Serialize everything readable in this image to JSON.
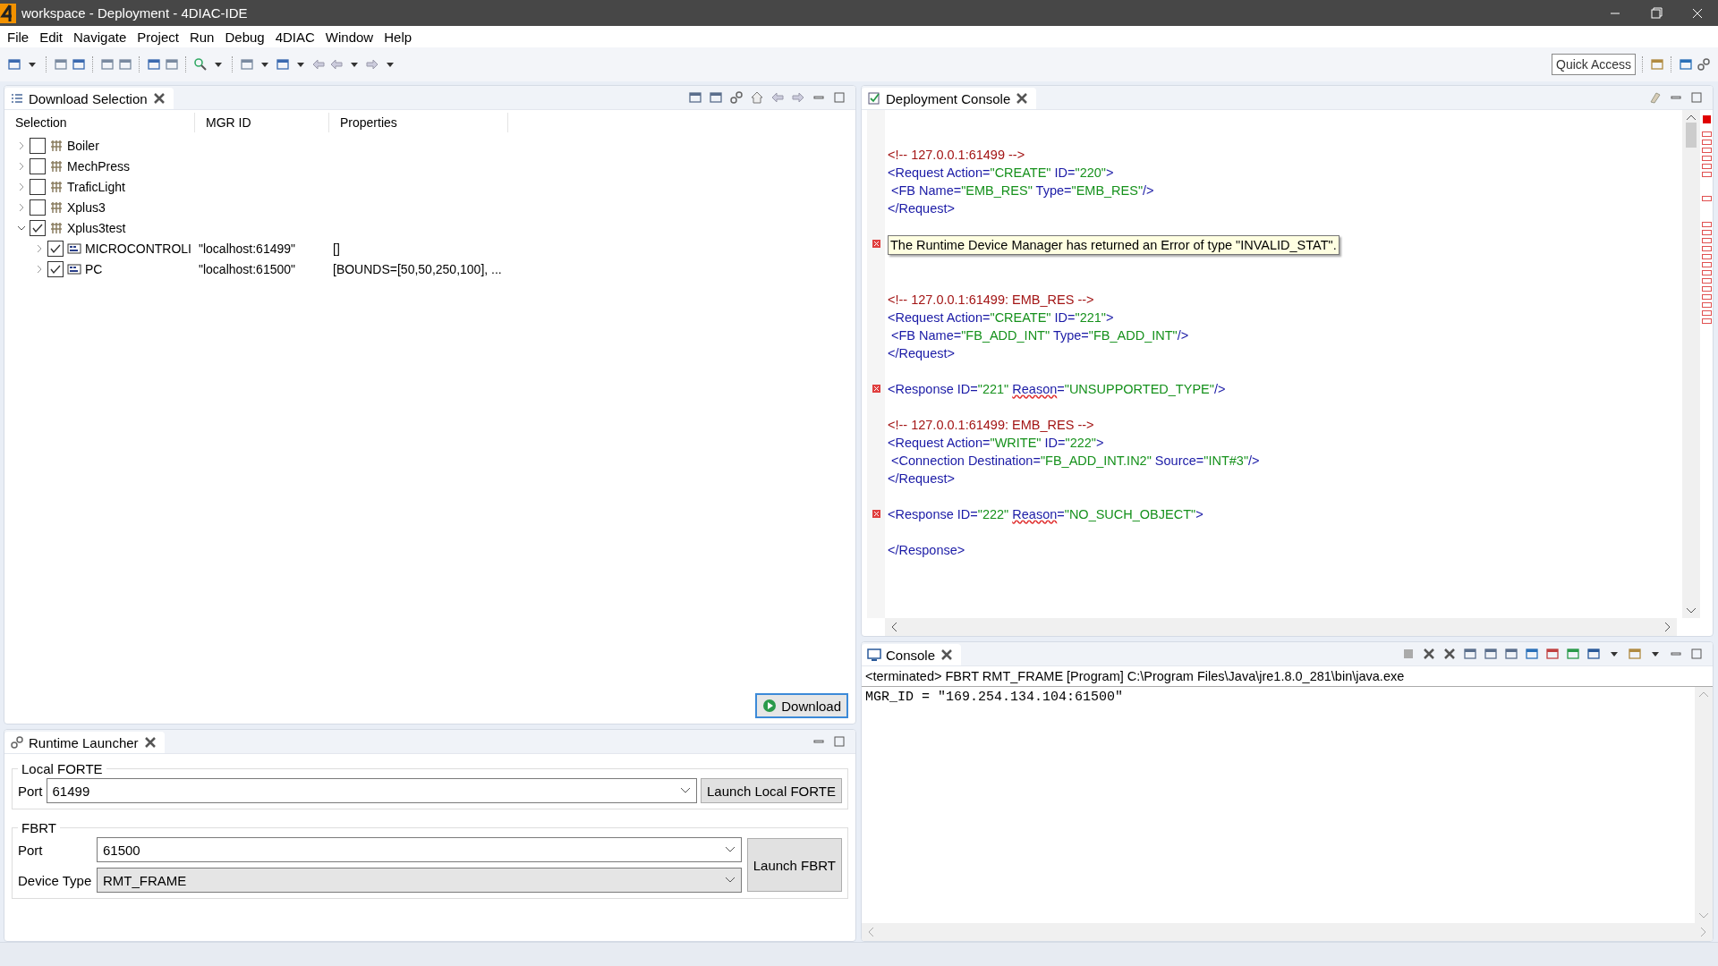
{
  "window": {
    "title": "workspace - Deployment - 4DIAC-IDE"
  },
  "menu": [
    "File",
    "Edit",
    "Navigate",
    "Project",
    "Run",
    "Debug",
    "4DIAC",
    "Window",
    "Help"
  ],
  "quick_access": {
    "placeholder": "Quick Access"
  },
  "download_selection": {
    "tab": "Download Selection",
    "columns": [
      "Selection",
      "MGR ID",
      "Properties"
    ],
    "tree": [
      {
        "label": "Boiler",
        "kind": "system",
        "checked": false,
        "expanded": false
      },
      {
        "label": "MechPress",
        "kind": "system",
        "checked": false,
        "expanded": false
      },
      {
        "label": "TraficLight",
        "kind": "system",
        "checked": false,
        "expanded": false
      },
      {
        "label": "Xplus3",
        "kind": "system",
        "checked": false,
        "expanded": false
      },
      {
        "label": "Xplus3test",
        "kind": "system",
        "checked": true,
        "expanded": true,
        "children": [
          {
            "label": "MICROCONTROLI",
            "kind": "device",
            "checked": true,
            "expanded": false,
            "mgr_id": "\"localhost:61499\"",
            "properties": "[]"
          },
          {
            "label": "PC",
            "kind": "device",
            "checked": true,
            "expanded": false,
            "mgr_id": "\"localhost:61500\"",
            "properties": "[BOUNDS=[50,50,250,100], ..."
          }
        ]
      }
    ],
    "download_button": "Download"
  },
  "deployment_console": {
    "tab": "Deployment Console",
    "entries": [
      {
        "kind": "request",
        "error": false,
        "lines": [
          [
            {
              "kind": "comment",
              "text": "<!-- 127.0.0.1:61499 -->"
            }
          ],
          [
            {
              "kind": "tag",
              "text": "<Request Action="
            },
            {
              "kind": "value",
              "text": "\"CREATE\""
            },
            {
              "kind": "tag",
              "text": " ID="
            },
            {
              "kind": "value",
              "text": "\"220\""
            },
            {
              "kind": "tag",
              "text": ">"
            }
          ],
          [
            {
              "kind": "tag",
              "text": " <FB Name="
            },
            {
              "kind": "value",
              "text": "\"EMB_RES\""
            },
            {
              "kind": "tag",
              "text": " Type="
            },
            {
              "kind": "value",
              "text": "\"EMB_RES\""
            },
            {
              "kind": "tag",
              "text": "/>"
            }
          ],
          [
            {
              "kind": "tag",
              "text": "</Request>"
            }
          ]
        ]
      },
      {
        "kind": "message",
        "error": true,
        "lines": [
          [
            {
              "kind": "plain",
              "text": "The Runtime Device Manager has returned an Error of type \"INVALID_STAT\"."
            }
          ]
        ]
      },
      {
        "kind": "request",
        "error": false,
        "lines": [
          [
            {
              "kind": "comment",
              "text": "<!-- 127.0.0.1:61499: EMB_RES -->"
            }
          ],
          [
            {
              "kind": "tag",
              "text": "<Request Action="
            },
            {
              "kind": "value",
              "text": "\"CREATE\""
            },
            {
              "kind": "tag",
              "text": " ID="
            },
            {
              "kind": "value",
              "text": "\"221\""
            },
            {
              "kind": "tag",
              "text": ">"
            }
          ],
          [
            {
              "kind": "tag",
              "text": " <FB Name="
            },
            {
              "kind": "value",
              "text": "\"FB_ADD_INT\""
            },
            {
              "kind": "tag",
              "text": " Type="
            },
            {
              "kind": "value",
              "text": "\"FB_ADD_INT\""
            },
            {
              "kind": "tag",
              "text": "/>"
            }
          ],
          [
            {
              "kind": "tag",
              "text": "</Request>"
            }
          ]
        ]
      },
      {
        "kind": "response",
        "error": true,
        "lines": [
          [
            {
              "kind": "tag",
              "text": "<Response ID="
            },
            {
              "kind": "value",
              "text": "\"221\" "
            },
            {
              "kind": "flagged",
              "text": "Reason"
            },
            {
              "kind": "tag",
              "text": "="
            },
            {
              "kind": "value",
              "text": "\"UNSUPPORTED_TYPE\""
            },
            {
              "kind": "tag",
              "text": "/>"
            }
          ]
        ]
      },
      {
        "kind": "request",
        "error": false,
        "lines": [
          [
            {
              "kind": "comment",
              "text": "<!-- 127.0.0.1:61499: EMB_RES -->"
            }
          ],
          [
            {
              "kind": "tag",
              "text": "<Request Action="
            },
            {
              "kind": "value",
              "text": "\"WRITE\""
            },
            {
              "kind": "tag",
              "text": " ID="
            },
            {
              "kind": "value",
              "text": "\"222\""
            },
            {
              "kind": "tag",
              "text": ">"
            }
          ],
          [
            {
              "kind": "tag",
              "text": " <Connection Destination="
            },
            {
              "kind": "value",
              "text": "\"FB_ADD_INT.IN2\""
            },
            {
              "kind": "tag",
              "text": " Source="
            },
            {
              "kind": "value",
              "text": "\"INT#3\""
            },
            {
              "kind": "tag",
              "text": "/>"
            }
          ],
          [
            {
              "kind": "tag",
              "text": "</Request>"
            }
          ]
        ]
      },
      {
        "kind": "response",
        "error": true,
        "lines": [
          [
            {
              "kind": "tag",
              "text": "<Response ID="
            },
            {
              "kind": "value",
              "text": "\"222\" "
            },
            {
              "kind": "flagged",
              "text": "Reason"
            },
            {
              "kind": "tag",
              "text": "="
            },
            {
              "kind": "value",
              "text": "\"NO_SUCH_OBJECT\""
            },
            {
              "kind": "tag",
              "text": ">"
            }
          ]
        ]
      },
      {
        "kind": "response",
        "error": false,
        "lines": [
          [
            {
              "kind": "tag",
              "text": "</Response>"
            }
          ]
        ]
      }
    ]
  },
  "runtime_launcher": {
    "tab": "Runtime Launcher",
    "local_forte": {
      "legend": "Local FORTE",
      "port_label": "Port",
      "port": "61499",
      "button": "Launch Local FORTE"
    },
    "fbrt": {
      "legend": "FBRT",
      "port_label": "Port",
      "port": "61500",
      "device_type_label": "Device Type",
      "device_type": "RMT_FRAME",
      "button": "Launch FBRT"
    }
  },
  "console": {
    "tab": "Console",
    "description": "<terminated> FBRT RMT_FRAME [Program] C:\\Program Files\\Java\\jre1.8.0_281\\bin\\java.exe",
    "output": "MGR_ID = \"169.254.134.104:61500\""
  }
}
